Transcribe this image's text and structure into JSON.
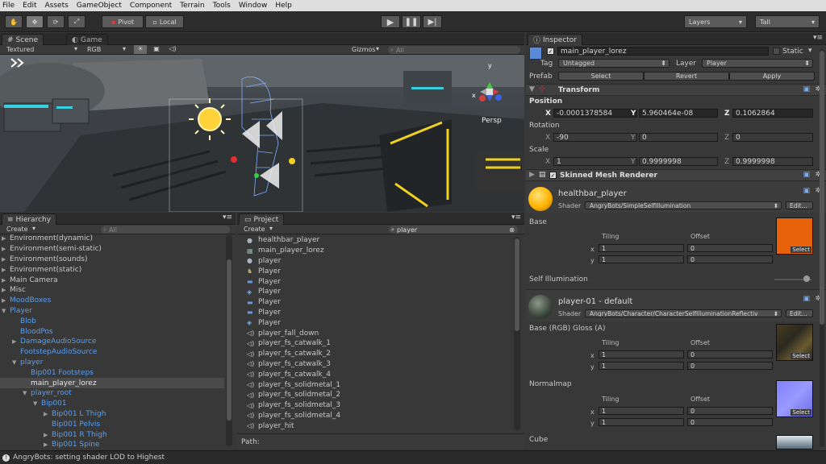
{
  "menubar": {
    "items": [
      "File",
      "Edit",
      "Assets",
      "GameObject",
      "Component",
      "Terrain",
      "Tools",
      "Window",
      "Help"
    ]
  },
  "toolbar": {
    "pivot": "Pivot",
    "local": "Local",
    "layers": "Layers",
    "layout": "Tall"
  },
  "scene": {
    "tab_scene": "Scene",
    "tab_game": "Game",
    "render_mode": "Textured",
    "channel": "RGB",
    "gizmos": "Gizmos",
    "search_placeholder": "All",
    "persp": "Persp",
    "axis_y": "y",
    "axis_x": "x"
  },
  "hierarchy": {
    "title": "Hierarchy",
    "create": "Create",
    "search_placeholder": "All",
    "items": [
      {
        "label": "Environment(dynamic)",
        "indent": 0,
        "arrow": "▶",
        "blue": false,
        "selected": false
      },
      {
        "label": "Environment(semi-static)",
        "indent": 0,
        "arrow": "▶",
        "blue": false,
        "selected": false
      },
      {
        "label": "Environment(sounds)",
        "indent": 0,
        "arrow": "▶",
        "blue": false,
        "selected": false
      },
      {
        "label": "Environment(static)",
        "indent": 0,
        "arrow": "▶",
        "blue": false,
        "selected": false
      },
      {
        "label": "Main Camera",
        "indent": 0,
        "arrow": "▶",
        "blue": false,
        "selected": false
      },
      {
        "label": "Misc",
        "indent": 0,
        "arrow": "▶",
        "blue": false,
        "selected": false
      },
      {
        "label": "MoodBoxes",
        "indent": 0,
        "arrow": "▶",
        "blue": true,
        "selected": false
      },
      {
        "label": "Player",
        "indent": 0,
        "arrow": "▼",
        "blue": true,
        "selected": false
      },
      {
        "label": "Blob",
        "indent": 1,
        "arrow": "",
        "blue": true,
        "selected": false
      },
      {
        "label": "BloodPos",
        "indent": 1,
        "arrow": "",
        "blue": true,
        "selected": false
      },
      {
        "label": "DamageAudioSource",
        "indent": 1,
        "arrow": "▶",
        "blue": true,
        "selected": false
      },
      {
        "label": "FootstepAudioSource",
        "indent": 1,
        "arrow": "",
        "blue": true,
        "selected": false
      },
      {
        "label": "player",
        "indent": 1,
        "arrow": "▼",
        "blue": true,
        "selected": false
      },
      {
        "label": "Bip001 Footsteps",
        "indent": 2,
        "arrow": "",
        "blue": true,
        "selected": false
      },
      {
        "label": "main_player_lorez",
        "indent": 2,
        "arrow": "",
        "blue": false,
        "selected": true
      },
      {
        "label": "player_root",
        "indent": 2,
        "arrow": "▼",
        "blue": true,
        "selected": false
      },
      {
        "label": "Bip001",
        "indent": 3,
        "arrow": "▼",
        "blue": true,
        "selected": false
      },
      {
        "label": "Bip001 L Thigh",
        "indent": 4,
        "arrow": "▶",
        "blue": true,
        "selected": false
      },
      {
        "label": "Bip001 Pelvis",
        "indent": 4,
        "arrow": "",
        "blue": true,
        "selected": false
      },
      {
        "label": "Bip001 R Thigh",
        "indent": 4,
        "arrow": "▶",
        "blue": true,
        "selected": false
      },
      {
        "label": "Bip001 Spine",
        "indent": 4,
        "arrow": "▶",
        "blue": true,
        "selected": false
      }
    ]
  },
  "project": {
    "title": "Project",
    "create": "Create",
    "search_value": "player",
    "path_label": "Path:",
    "items": [
      {
        "label": "healthbar_player",
        "icon": "sphere-icon"
      },
      {
        "label": "main_player_lorez",
        "icon": "mesh-icon"
      },
      {
        "label": "player",
        "icon": "sphere-icon"
      },
      {
        "label": "Player",
        "icon": "model-icon"
      },
      {
        "label": "Player",
        "icon": "folder-icon"
      },
      {
        "label": "Player",
        "icon": "prefab-icon"
      },
      {
        "label": "Player",
        "icon": "folder-icon"
      },
      {
        "label": "Player",
        "icon": "folder-icon"
      },
      {
        "label": "Player",
        "icon": "prefab-icon"
      },
      {
        "label": "player_fall_down",
        "icon": "audio-icon"
      },
      {
        "label": "player_fs_catwalk_1",
        "icon": "audio-icon"
      },
      {
        "label": "player_fs_catwalk_2",
        "icon": "audio-icon"
      },
      {
        "label": "player_fs_catwalk_3",
        "icon": "audio-icon"
      },
      {
        "label": "player_fs_catwalk_4",
        "icon": "audio-icon"
      },
      {
        "label": "player_fs_solidmetal_1",
        "icon": "audio-icon"
      },
      {
        "label": "player_fs_solidmetal_2",
        "icon": "audio-icon"
      },
      {
        "label": "player_fs_solidmetal_3",
        "icon": "audio-icon"
      },
      {
        "label": "player_fs_solidmetal_4",
        "icon": "audio-icon"
      },
      {
        "label": "player_hit",
        "icon": "audio-icon"
      }
    ]
  },
  "inspector": {
    "title": "Inspector",
    "object_name": "main_player_lorez",
    "static_label": "Static",
    "tag_label": "Tag",
    "tag_value": "Untagged",
    "layer_label": "Layer",
    "layer_value": "Player",
    "prefab_label": "Prefab",
    "prefab_select": "Select",
    "prefab_revert": "Revert",
    "prefab_apply": "Apply",
    "transform": {
      "title": "Transform",
      "position_label": "Position",
      "rotation_label": "Rotation",
      "scale_label": "Scale",
      "x": "X",
      "y": "Y",
      "z": "Z",
      "position": {
        "x": "-0.0001378584",
        "y": "5.960464e-08",
        "z": "0.1062864"
      },
      "rotation": {
        "x": "-90",
        "y": "0",
        "z": "0"
      },
      "scale": {
        "x": "1",
        "y": "0.9999998",
        "z": "0.9999998"
      }
    },
    "skinned": {
      "title": "Skinned Mesh Renderer"
    },
    "mat1": {
      "name": "healthbar_player",
      "shader_label": "Shader",
      "shader": "AngryBots/SimpleSelfIllumination",
      "edit": "Edit...",
      "base_label": "Base",
      "tiling": "Tiling",
      "offset": "Offset",
      "x": "x",
      "y": "y",
      "tx": "1",
      "ty": "1",
      "ox": "0",
      "oy": "0",
      "select": "Select",
      "self_illum": "Self Illumination",
      "color": "#ffb300",
      "swatch": "#e8620c"
    },
    "mat2": {
      "name": "player-01 - default",
      "shader_label": "Shader",
      "shader": "AngryBots/Character/CharacterSelfIlluminationReflectiv",
      "edit": "Edit...",
      "base_label": "Base (RGB) Gloss (A)",
      "tiling": "Tiling",
      "offset": "Offset",
      "x": "x",
      "y": "y",
      "tx": "1",
      "ty": "1",
      "ox": "0",
      "oy": "0",
      "select": "Select",
      "normal_label": "Normalmap",
      "ntx": "1",
      "nty": "1",
      "nox": "0",
      "noy": "0",
      "cube_label": "Cube"
    }
  },
  "status": {
    "message": "AngryBots: setting shader LOD to Highest"
  }
}
